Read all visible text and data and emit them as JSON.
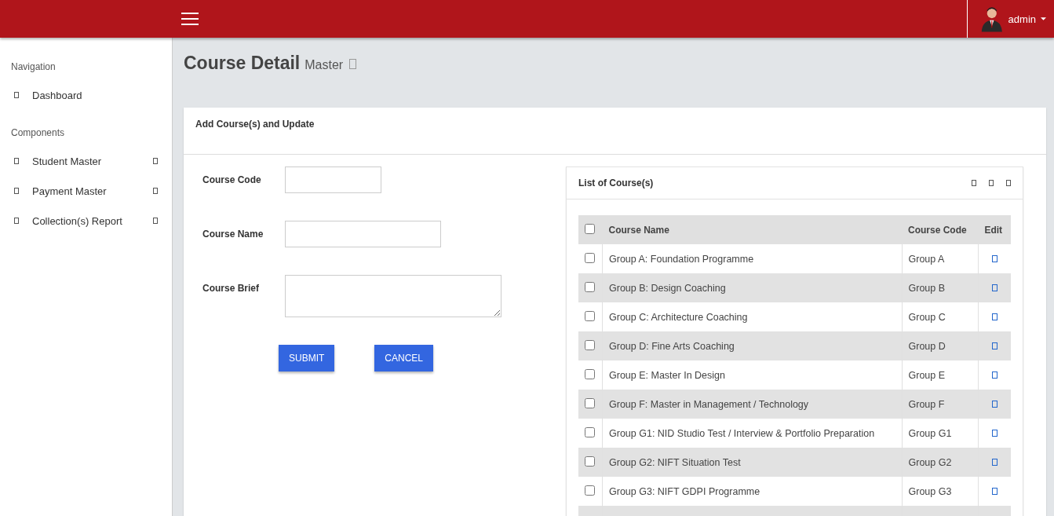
{
  "topbar": {
    "user": "admin"
  },
  "sidebar": {
    "sections": [
      {
        "title": "Navigation",
        "items": [
          {
            "label": "Dashboard",
            "expandable": false
          }
        ]
      },
      {
        "title": "Components",
        "items": [
          {
            "label": "Student Master",
            "expandable": true
          },
          {
            "label": "Payment Master",
            "expandable": true
          },
          {
            "label": "Collection(s) Report",
            "expandable": true
          }
        ]
      }
    ]
  },
  "page": {
    "title": "Course Detail",
    "subtitle": "Master"
  },
  "card": {
    "title": "Add Course(s) and Update",
    "form": {
      "fields": [
        {
          "label": "Course Code",
          "kind": "short"
        },
        {
          "label": "Course Name",
          "kind": "medium"
        },
        {
          "label": "Course Brief",
          "kind": "textarea"
        }
      ],
      "buttons": [
        "SUBMIT",
        "CANCEL"
      ]
    },
    "list": {
      "title": "List of Course(s)",
      "columns": [
        "Course Name",
        "Course Code",
        "Edit"
      ],
      "all_checked": false,
      "rows": [
        {
          "name": "Group A: Foundation Programme",
          "code": "Group A",
          "checked": false
        },
        {
          "name": "Group B: Design Coaching",
          "code": "Group B",
          "checked": false
        },
        {
          "name": "Group C: Architecture Coaching",
          "code": "Group C",
          "checked": false
        },
        {
          "name": "Group D: Fine Arts Coaching",
          "code": "Group D",
          "checked": false
        },
        {
          "name": "Group E: Master In Design",
          "code": "Group E",
          "checked": false
        },
        {
          "name": "Group F: Master in Management / Technology",
          "code": "Group F",
          "checked": false
        },
        {
          "name": "Group G1: NID Studio Test / Interview & Portfolio Preparation",
          "code": "Group G1",
          "checked": false
        },
        {
          "name": "Group G2: NIFT Situation Test",
          "code": "Group G2",
          "checked": false
        },
        {
          "name": "Group G3: NIFT GDPI Programme",
          "code": "Group G3",
          "checked": false
        }
      ]
    }
  }
}
